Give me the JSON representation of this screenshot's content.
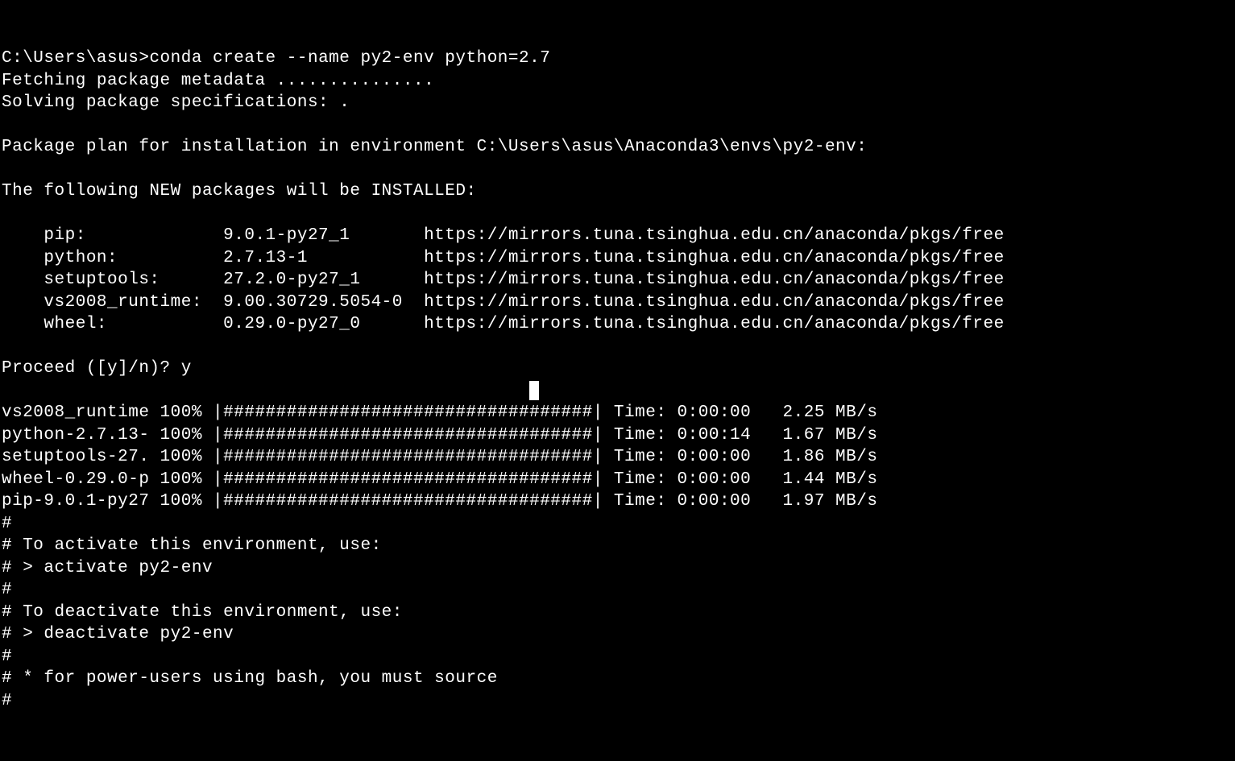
{
  "prompt": "C:\\Users\\asus>",
  "command": "conda create --name py2-env python=2.7",
  "fetching": "Fetching package metadata ...............",
  "solving": "Solving package specifications: .",
  "plan_header": "Package plan for installation in environment C:\\Users\\asus\\Anaconda3\\envs\\py2-env:",
  "new_pkgs_header": "The following NEW packages will be INSTALLED:",
  "packages": [
    {
      "name": "pip:",
      "ver": "9.0.1-py27_1",
      "url": "https://mirrors.tuna.tsinghua.edu.cn/anaconda/pkgs/free"
    },
    {
      "name": "python:",
      "ver": "2.7.13-1",
      "url": "https://mirrors.tuna.tsinghua.edu.cn/anaconda/pkgs/free"
    },
    {
      "name": "setuptools:",
      "ver": "27.2.0-py27_1",
      "url": "https://mirrors.tuna.tsinghua.edu.cn/anaconda/pkgs/free"
    },
    {
      "name": "vs2008_runtime:",
      "ver": "9.00.30729.5054-0",
      "url": "https://mirrors.tuna.tsinghua.edu.cn/anaconda/pkgs/free"
    },
    {
      "name": "wheel:",
      "ver": "0.29.0-py27_0",
      "url": "https://mirrors.tuna.tsinghua.edu.cn/anaconda/pkgs/free"
    }
  ],
  "proceed_prompt": "Proceed ([y]/n)? ",
  "proceed_answer": "y",
  "progress": [
    {
      "pkg": "vs2008_runtime",
      "pct": "100%",
      "bar": "|###################################|",
      "time": "Time: 0:00:00",
      "speed": "2.25 MB/s"
    },
    {
      "pkg": "python-2.7.13-",
      "pct": "100%",
      "bar": "|###################################|",
      "time": "Time: 0:00:14",
      "speed": "1.67 MB/s"
    },
    {
      "pkg": "setuptools-27.",
      "pct": "100%",
      "bar": "|###################################|",
      "time": "Time: 0:00:00",
      "speed": "1.86 MB/s"
    },
    {
      "pkg": "wheel-0.29.0-p",
      "pct": "100%",
      "bar": "|###################################|",
      "time": "Time: 0:00:00",
      "speed": "1.44 MB/s"
    },
    {
      "pkg": "pip-9.0.1-py27",
      "pct": "100%",
      "bar": "|###################################|",
      "time": "Time: 0:00:00",
      "speed": "1.97 MB/s"
    }
  ],
  "footer": [
    "#",
    "# To activate this environment, use:",
    "# > activate py2-env",
    "#",
    "# To deactivate this environment, use:",
    "# > deactivate py2-env",
    "#",
    "# * for power-users using bash, you must source",
    "#"
  ]
}
